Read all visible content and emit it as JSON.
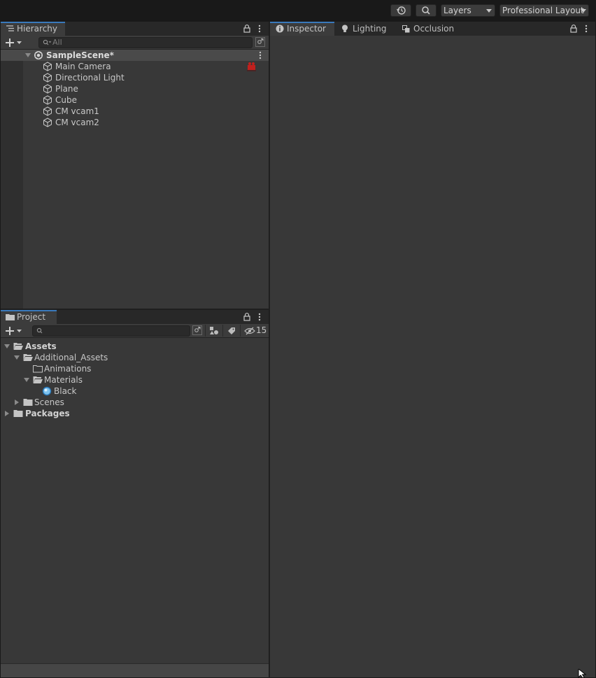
{
  "toolbar": {
    "layers_label": "Layers",
    "layout_label": "Professional Layout"
  },
  "hierarchy": {
    "tab_label": "Hierarchy",
    "search_placeholder": "All",
    "scene_name": "SampleScene*",
    "objects": [
      "Main Camera",
      "Directional Light",
      "Plane",
      "Cube",
      "CM vcam1",
      "CM vcam2"
    ]
  },
  "inspector": {
    "tabs": [
      "Inspector",
      "Lighting",
      "Occlusion"
    ]
  },
  "project": {
    "tab_label": "Project",
    "hidden_count": "15",
    "tree": {
      "assets": "Assets",
      "additional_assets": "Additional_Assets",
      "animations": "Animations",
      "materials": "Materials",
      "black": "Black",
      "scenes": "Scenes",
      "packages": "Packages"
    }
  },
  "colors": {
    "accent": "#3a79bb",
    "panel_bg": "#383838",
    "toolbar_bg": "#191919",
    "camera_gizmo": "#c0201d"
  },
  "icons": [
    "history-icon",
    "search-icon",
    "lock-icon",
    "kebab-menu-icon",
    "plus-icon",
    "unity-scene-icon",
    "gameobject-cube-icon",
    "folder-icon",
    "folder-open-icon",
    "material-sphere-icon",
    "info-icon",
    "lightbulb-icon",
    "occlusion-icon",
    "eye-slash-icon",
    "tag-icon",
    "filter-by-type-icon"
  ]
}
